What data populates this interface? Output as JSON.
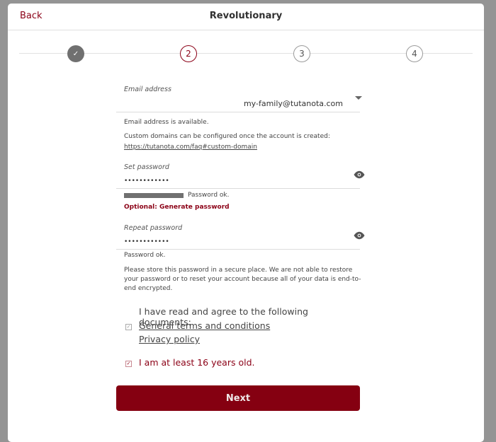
{
  "header": {
    "back_label": "Back",
    "title": "Revolutionary"
  },
  "stepper": {
    "steps": [
      {
        "label": "✓",
        "state": "done"
      },
      {
        "label": "2",
        "state": "active"
      },
      {
        "label": "3",
        "state": "todo"
      },
      {
        "label": "4",
        "state": "todo"
      }
    ]
  },
  "email": {
    "label": "Email address",
    "value": "my-family@tutanota.com",
    "status": "Email address is available.",
    "custom_domain_info": "Custom domains can be configured once the account is created:",
    "custom_domain_link": "https://tutanota.com/faq#custom-domain"
  },
  "password": {
    "label": "Set password",
    "value": "••••••••••••",
    "strength_percent": 100,
    "status": "Password ok.",
    "generate_label": "Optional: Generate password"
  },
  "repeat_password": {
    "label": "Repeat password",
    "value": "••••••••••••",
    "status": "Password ok.",
    "notice": "Please store this password in a secure place. We are not able to restore your password or to reset your account because all of your data is end-to-end encrypted."
  },
  "terms": {
    "intro": "I have read and agree to the following documents:",
    "terms_link": "General terms and conditions",
    "privacy_link": "Privacy policy",
    "terms_checked": true,
    "age_label": "I am at least 16 years old.",
    "age_checked": true
  },
  "next_label": "Next",
  "colors": {
    "accent": "#850011",
    "step_done": "#707070"
  }
}
